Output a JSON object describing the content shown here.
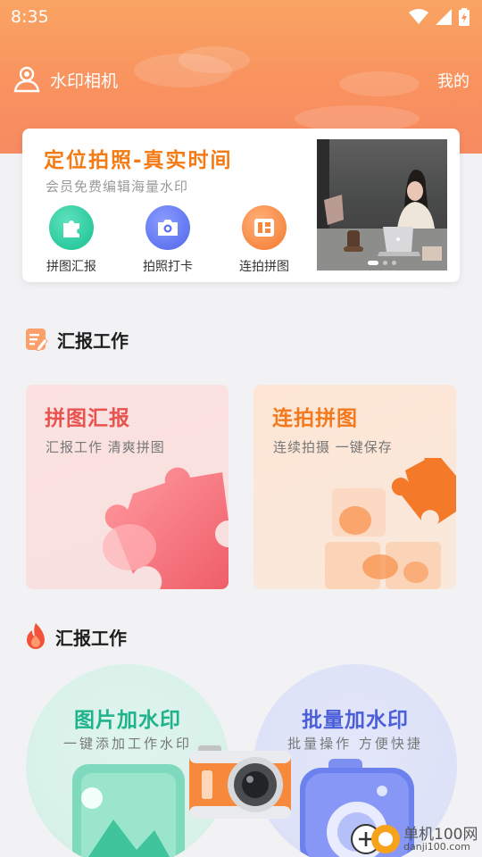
{
  "status_bar": {
    "time": "8:35"
  },
  "header": {
    "title": "水印相机",
    "mine_label": "我的"
  },
  "promo": {
    "headline": "定位拍照-真实时间",
    "subtitle": "会员免费编辑海量水印",
    "quick_actions": [
      {
        "label": "拼图汇报",
        "icon": "puzzle-icon",
        "color": "#21c99a"
      },
      {
        "label": "拍照打卡",
        "icon": "camera-icon",
        "color": "#5b73f0"
      },
      {
        "label": "连拍拼图",
        "icon": "layout-icon",
        "color": "#f7873a"
      }
    ],
    "carousel": {
      "count": 3,
      "active": 0
    }
  },
  "section1": {
    "title": "汇报工作",
    "icon": "report-icon"
  },
  "feature_cards": [
    {
      "title": "拼图汇报",
      "subtitle": "汇报工作 清爽拼图",
      "title_color": "#e9534f"
    },
    {
      "title": "连拍拼图",
      "subtitle": "连续拍摄  一键保存",
      "title_color": "#f4781c"
    }
  ],
  "section2": {
    "title": "汇报工作",
    "icon": "flame-icon"
  },
  "circle_cards": [
    {
      "title": "图片加水印",
      "subtitle": "一键添加工作水印",
      "title_color": "#1fb38c"
    },
    {
      "title": "批量加水印",
      "subtitle": "批量操作 方便快捷",
      "title_color": "#4b5fd8"
    }
  ],
  "watermark": {
    "name": "单机100网",
    "url": "danji100.com"
  },
  "colors": {
    "header_orange": "#f9925f",
    "accent": "#f37a14"
  }
}
